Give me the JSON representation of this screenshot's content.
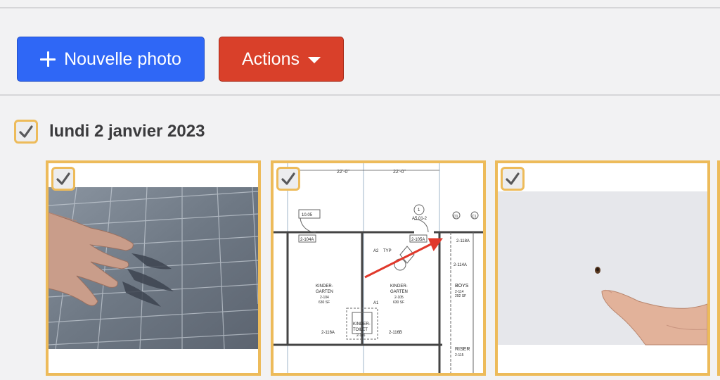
{
  "toolbar": {
    "new_photo_label": "Nouvelle photo",
    "actions_label": "Actions"
  },
  "group": {
    "date": "lundi 2 janvier 2023",
    "selected": true
  },
  "photos": [
    {
      "subject": "hand on solar panel",
      "selected": true
    },
    {
      "subject": "architectural floor plan",
      "selected": true,
      "labels": {
        "dim1": "22'-0\"",
        "dim2": "22'-0\"",
        "callout": "10.05",
        "ref": "A5.01-2",
        "ref_num": "1",
        "room_a": "2-104A",
        "room_b": "2-105A",
        "typ": "TYP",
        "a2": "A2",
        "kg1_l1": "KINDER-",
        "kg1_l2": "GARTEN",
        "kg1_num": "2-104",
        "kg1_area": "630 SF",
        "kg2_l1": "KINDER-",
        "kg2_l2": "GARTEN",
        "kg2_num": "2-105",
        "kg2_area": "630 SF",
        "toilet_l1": "KINDER-",
        "toilet_l2": "TOILET",
        "toilet_num": "2-116",
        "d116a": "2-116A",
        "d116b": "2-116B",
        "a1": "A1",
        "r118a": "2-118A",
        "r114a": "2-114A",
        "boys": "BOYS",
        "boys_num": "2-114",
        "boys_area": "292 SF",
        "riser": "RISER",
        "riser_num": "2-115",
        "d1": "D1",
        "c1": "C1"
      }
    },
    {
      "subject": "finger pointing at hole in wall",
      "selected": true
    },
    {
      "subject": "partially visible photo",
      "selected": true
    }
  ],
  "colors": {
    "primary": "#2f67f6",
    "danger": "#d9402a",
    "selection": "#edbb5a",
    "annotation": "#e0382b"
  }
}
